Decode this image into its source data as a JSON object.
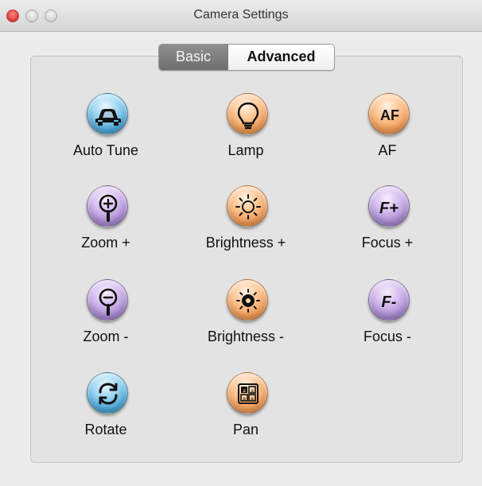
{
  "window": {
    "title": "Camera Settings"
  },
  "tabs": {
    "basic": "Basic",
    "advanced": "Advanced"
  },
  "controls": [
    {
      "label": "Auto Tune",
      "icon": "car-icon",
      "color": "blue"
    },
    {
      "label": "Lamp",
      "icon": "bulb-icon",
      "color": "orange"
    },
    {
      "label": "AF",
      "icon": "af-icon",
      "color": "orange"
    },
    {
      "label": "Zoom +",
      "icon": "zoom-in-icon",
      "color": "purple"
    },
    {
      "label": "Brightness +",
      "icon": "brightness-up-icon",
      "color": "orange"
    },
    {
      "label": "Focus +",
      "icon": "focus-plus-icon",
      "color": "purple"
    },
    {
      "label": "Zoom -",
      "icon": "zoom-out-icon",
      "color": "purple"
    },
    {
      "label": "Brightness -",
      "icon": "brightness-down-icon",
      "color": "orange"
    },
    {
      "label": "Focus -",
      "icon": "focus-minus-icon",
      "color": "purple"
    },
    {
      "label": "Rotate",
      "icon": "rotate-icon",
      "color": "blue"
    },
    {
      "label": "Pan",
      "icon": "pan-icon",
      "color": "orange"
    }
  ],
  "colors": {
    "blue": "#4aa7d8",
    "orange": "#f09a55",
    "purple": "#a889d0"
  }
}
